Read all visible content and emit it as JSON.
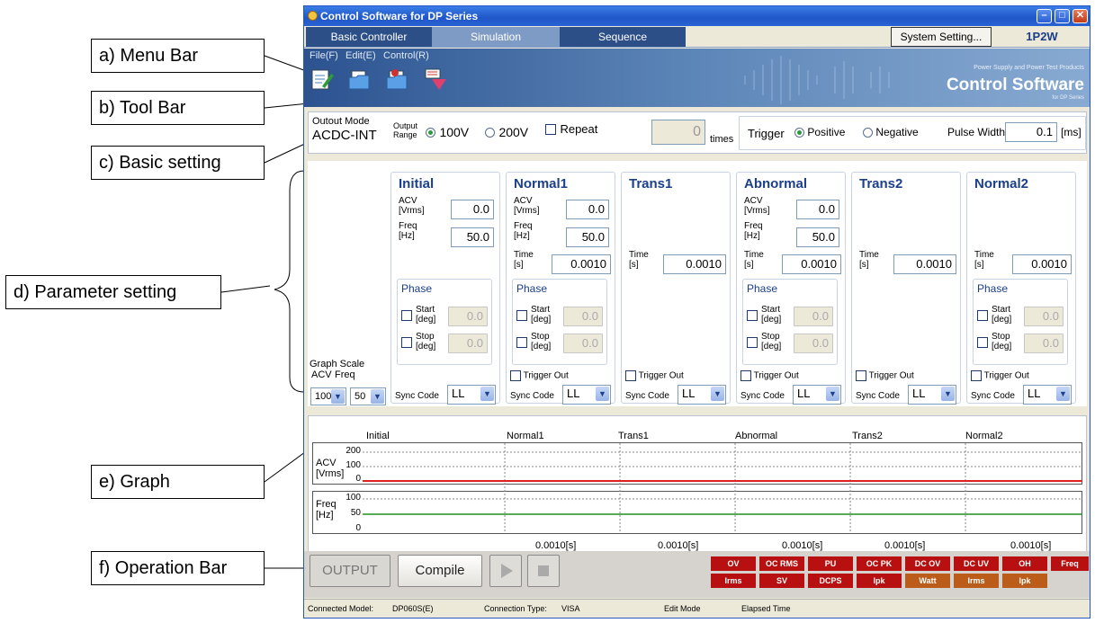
{
  "callouts": {
    "menu_bar": "a) Menu Bar",
    "tool_bar": "b) Tool Bar",
    "basic_setting": "c) Basic setting",
    "parameter_setting": "d) Parameter setting",
    "graph": "e) Graph",
    "operation_bar": "f) Operation Bar"
  },
  "window": {
    "title": "Control Software for DP Series"
  },
  "tabs": [
    "Basic Controller",
    "Simulation",
    "Sequence"
  ],
  "system_setting_button": "System Setting...",
  "mode_badge": "1P2W",
  "menu": {
    "file": "File(F)",
    "edit": "Edit(E)",
    "control": "Control(R)"
  },
  "brand": {
    "sub": "Power Supply and Power Test Products",
    "main": "Control Software",
    "dp": "for DP Series"
  },
  "toolbar_icons": [
    "edit-icon",
    "open-folder-icon",
    "save-icon",
    "run-tool-icon"
  ],
  "basic": {
    "output_mode_label": "Outout Mode",
    "output_mode_value": "ACDC-INT",
    "output_range_label": "Output Range",
    "range_100": "100V",
    "range_200": "200V",
    "repeat_label": "Repeat",
    "repeat_value": "0",
    "times_label": "times",
    "trigger_label": "Trigger",
    "positive_label": "Positive",
    "negative_label": "Negative",
    "pulse_width_label": "Pulse Width",
    "pulse_width_value": "0.1",
    "pulse_width_unit": "[ms]"
  },
  "graph_scale": {
    "label": "Graph Scale",
    "acv_label": "ACV",
    "freq_label": "Freq",
    "acv_value": "100",
    "freq_value": "50"
  },
  "steps": {
    "initial": {
      "name": "Initial",
      "acv": "0.0",
      "freq": "50.0",
      "phase_start": "0.0",
      "phase_stop": "0.0",
      "sync": "LL"
    },
    "normal1": {
      "name": "Normal1",
      "acv": "0.0",
      "freq": "50.0",
      "time": "0.0010",
      "phase_start": "0.0",
      "phase_stop": "0.0",
      "sync": "LL"
    },
    "trans1": {
      "name": "Trans1",
      "time": "0.0010",
      "sync": "LL"
    },
    "abnormal": {
      "name": "Abnormal",
      "acv": "0.0",
      "freq": "50.0",
      "time": "0.0010",
      "phase_start": "0.0",
      "phase_stop": "0.0",
      "sync": "LL"
    },
    "trans2": {
      "name": "Trans2",
      "time": "0.0010",
      "sync": "LL"
    },
    "normal2": {
      "name": "Normal2",
      "time": "0.0010",
      "phase_start": "0.0",
      "phase_stop": "0.0",
      "sync": "LL"
    }
  },
  "labels": {
    "acv": "ACV",
    "vrms": "[Vrms]",
    "freq": "Freq",
    "hz": "[Hz]",
    "time": "Time",
    "s": "[s]",
    "phase": "Phase",
    "start": "Start",
    "stop": "Stop",
    "deg": "[deg]",
    "trigger_out": "Trigger Out",
    "sync_code": "Sync Code"
  },
  "graph": {
    "columns": [
      "Initial",
      "Normal1",
      "Trans1",
      "Abnormal",
      "Trans2",
      "Normal2"
    ],
    "acv_ticks": [
      "200",
      "100",
      "0"
    ],
    "freq_ticks": [
      "100",
      "50",
      "0"
    ],
    "acv_axis": "ACV",
    "acv_unit": "[Vrms]",
    "freq_axis": "Freq",
    "freq_unit": "[Hz]",
    "durations": [
      "0.0010[s]",
      "0.0010[s]",
      "0.0010[s]",
      "0.0010[s]",
      "0.0010[s]"
    ],
    "acv_line_color": "#e02020",
    "freq_line_color": "#209020"
  },
  "operation": {
    "output": "OUTPUT",
    "compile": "Compile",
    "indicators_top": [
      "OV",
      "OC RMS",
      "PU",
      "OC PK",
      "DC OV",
      "DC UV",
      "OH",
      "Freq"
    ],
    "indicators_bottom": [
      "Irms",
      "SV",
      "DCPS",
      "Ipk",
      "Watt",
      "Irms",
      "Ipk"
    ]
  },
  "status": {
    "model_label": "Connected Model:",
    "model_value": "DP060S(E)",
    "conn_label": "Connection Type:",
    "conn_value": "VISA",
    "mode": "Edit Mode",
    "elapsed": "Elapsed Time"
  }
}
